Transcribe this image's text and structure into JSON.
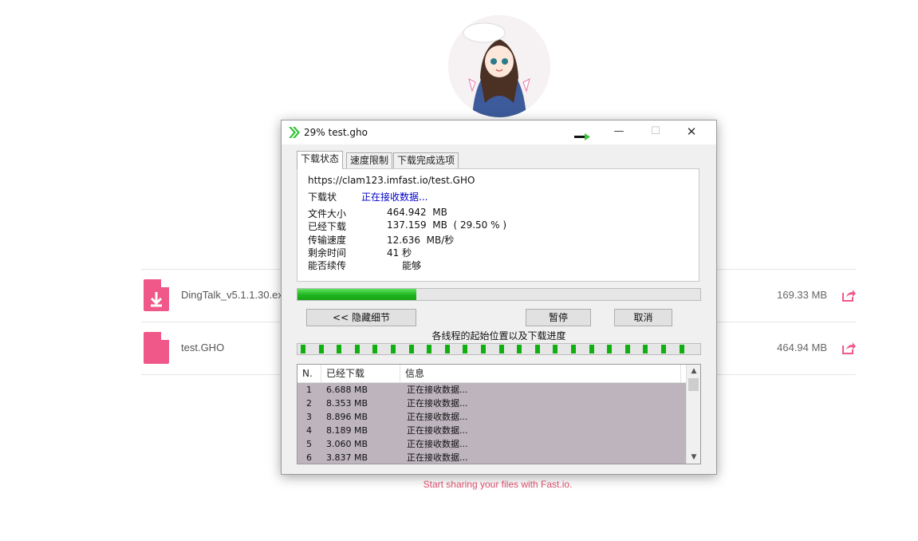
{
  "files": [
    {
      "name": "DingTalk_v5.1.1.30.exe",
      "size": "169.33 MB",
      "icon": "download-file-icon"
    },
    {
      "name": "test.GHO",
      "size": "464.94 MB",
      "icon": "file-icon"
    }
  ],
  "footer": "Start sharing your files with Fast.io.",
  "dialog": {
    "title": "29% test.gho",
    "minimize_glyph": "—",
    "maximize_glyph": "☐",
    "close_glyph": "✕",
    "tabs": [
      "下载状态",
      "速度限制",
      "下载完成选项"
    ],
    "url": "https://clam123.imfast.io/test.GHO",
    "status_label": "下载状",
    "status_value": "正在接收数据...",
    "info": [
      {
        "label": "文件大小",
        "value": "464.942  MB"
      },
      {
        "label": "已经下载",
        "value": "137.159  MB  ( 29.50 % )"
      },
      {
        "label": "传输速度",
        "value": "12.636  MB/秒"
      },
      {
        "label": "剩余时间",
        "value": "41 秒"
      },
      {
        "label": "能否续传",
        "value": "     能够"
      }
    ],
    "progress_percent": 29.5,
    "hide_details_button": "<< 隐藏细节",
    "pause_button": "暂停",
    "cancel_button": "取消",
    "segments_label": "各线程的起始位置以及下载进度",
    "table": {
      "headers": [
        "N.",
        "已经下载",
        "信息"
      ],
      "rows": [
        {
          "n": "1",
          "downloaded": "6.688  MB",
          "info": "正在接收数据..."
        },
        {
          "n": "2",
          "downloaded": "8.353  MB",
          "info": "正在接收数据..."
        },
        {
          "n": "3",
          "downloaded": "8.896  MB",
          "info": "正在接收数据..."
        },
        {
          "n": "4",
          "downloaded": "8.189  MB",
          "info": "正在接收数据..."
        },
        {
          "n": "5",
          "downloaded": "3.060  MB",
          "info": "正在接收数据..."
        },
        {
          "n": "6",
          "downloaded": "3.837  MB",
          "info": "正在接收数据..."
        }
      ]
    }
  },
  "colors": {
    "accent": "#f0588a",
    "progress": "#1fb51f",
    "status_text": "#0000c8",
    "footer": "#e05370"
  }
}
